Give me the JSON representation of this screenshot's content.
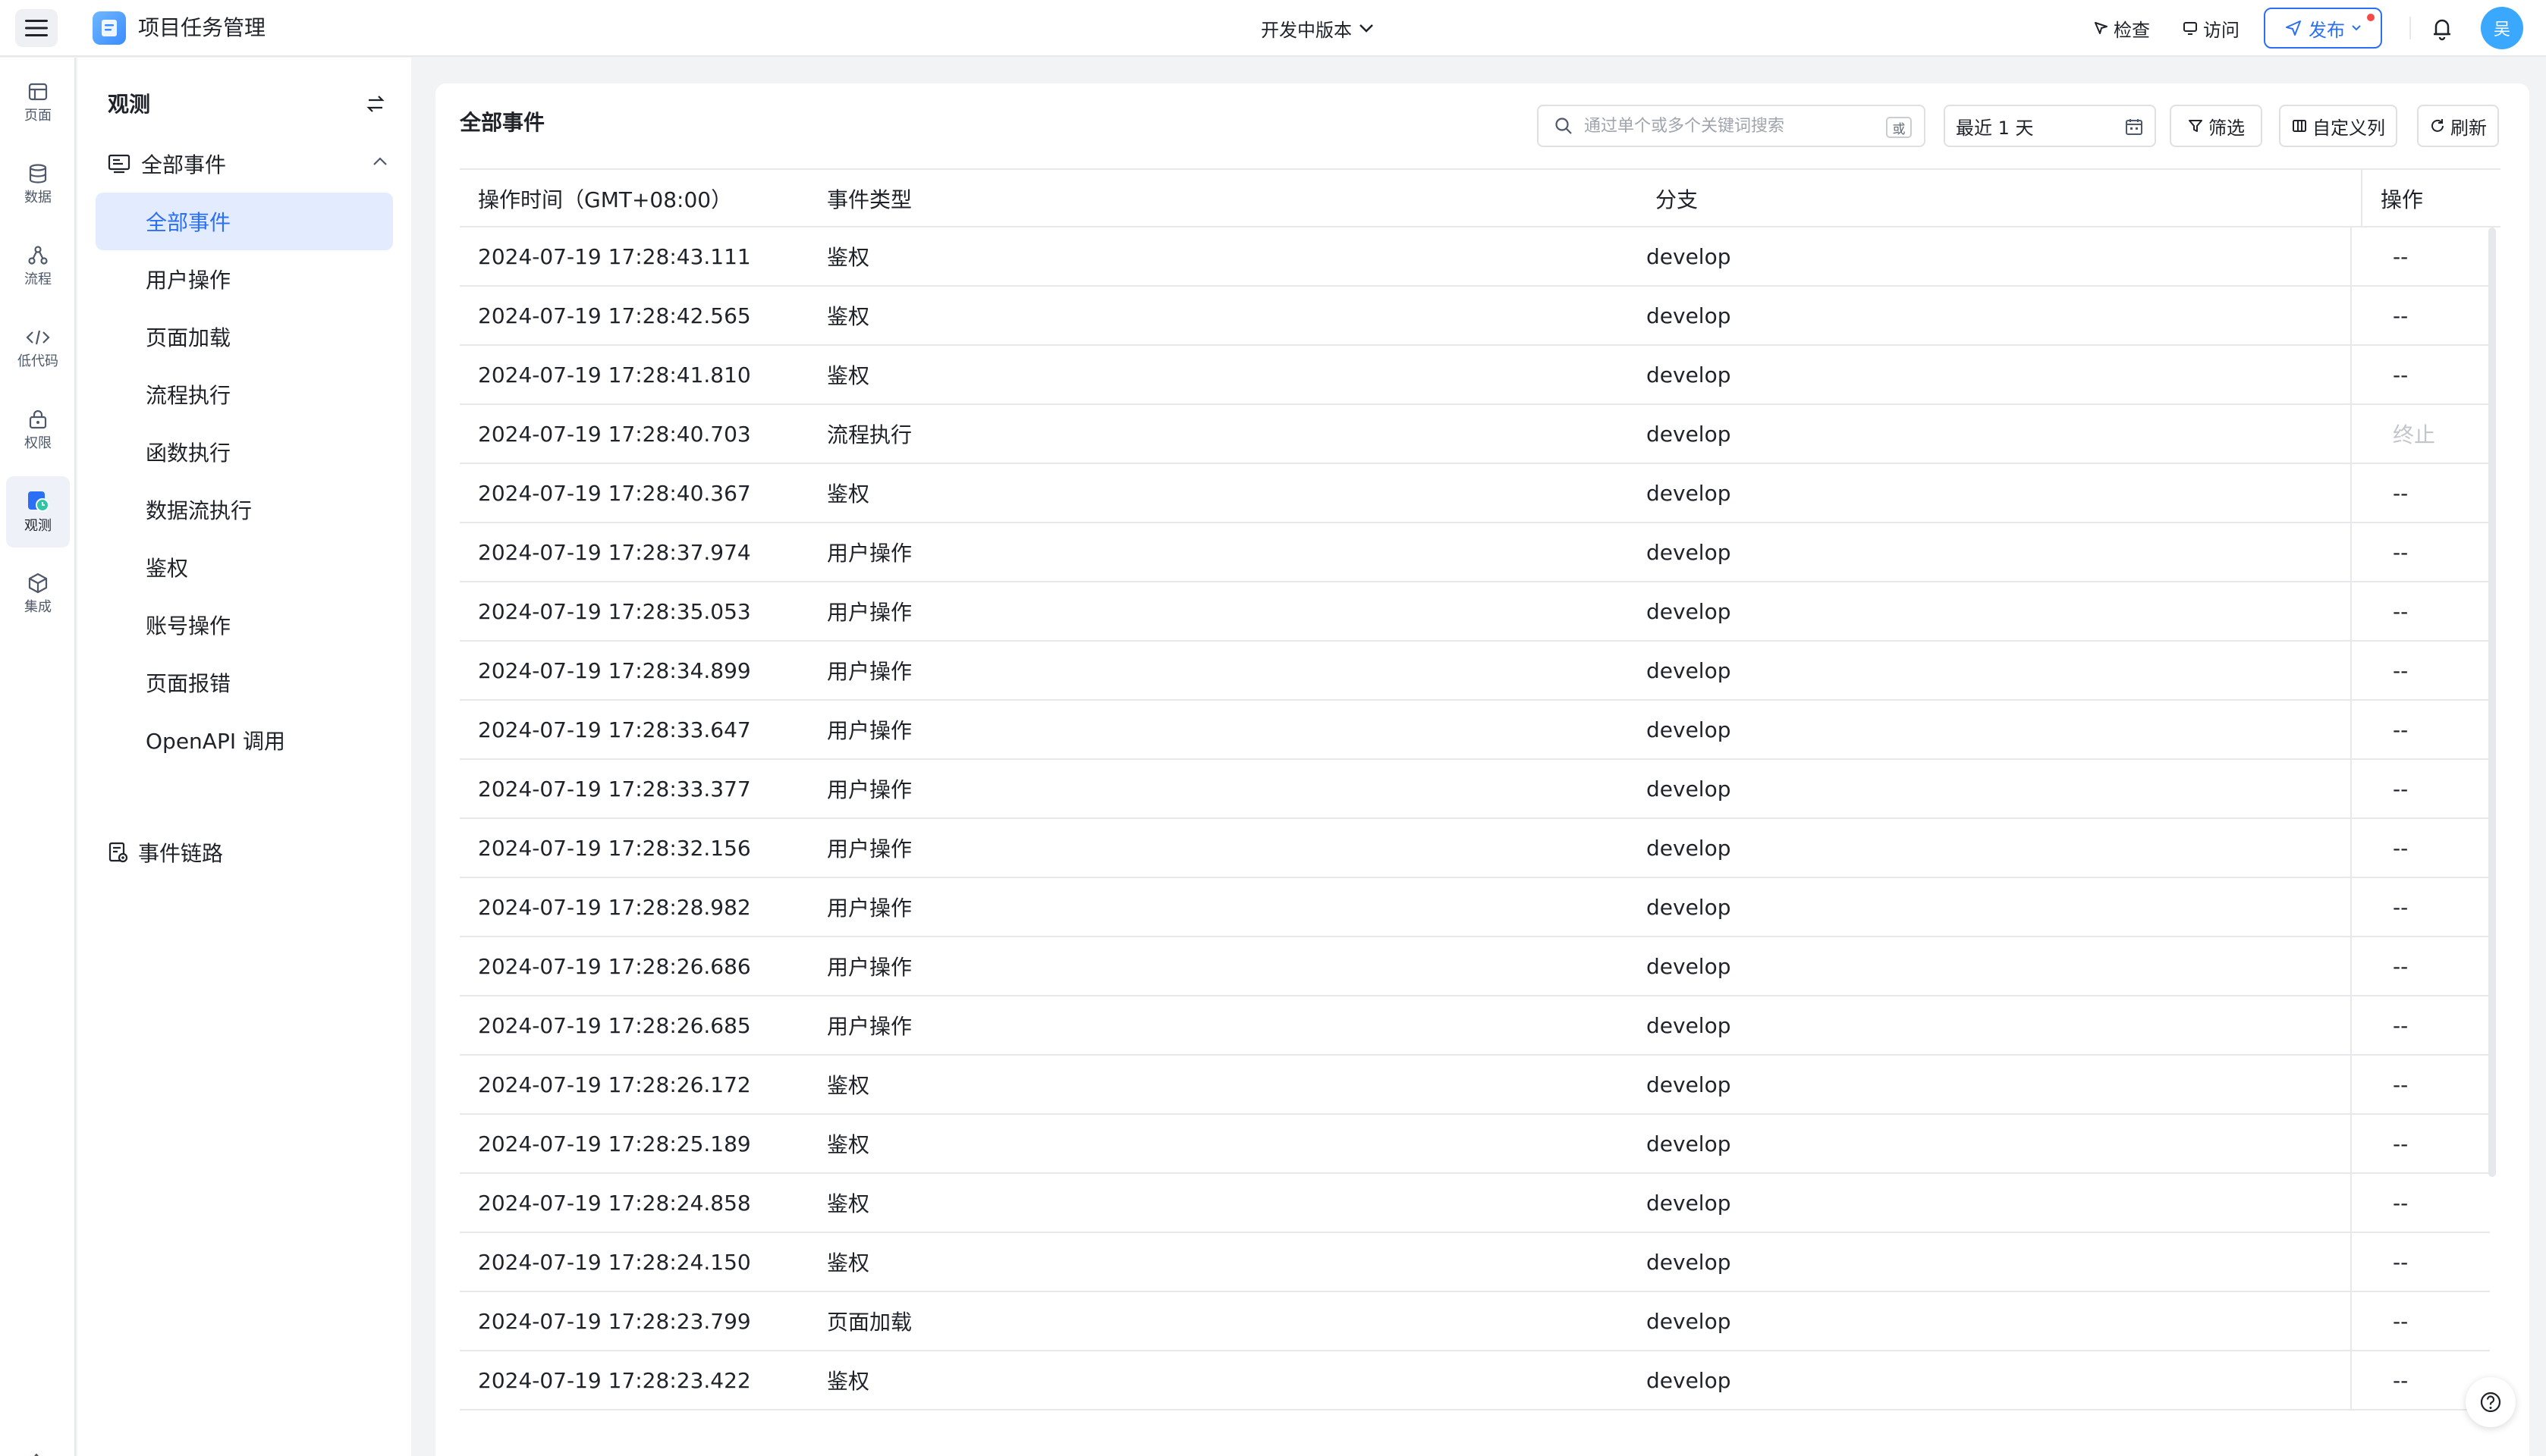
{
  "app": {
    "title": "项目任务管理",
    "version": "开发中版本"
  },
  "topbar": {
    "check": "检查",
    "visit": "访问",
    "publish": "发布",
    "avatar": "吴"
  },
  "rail": [
    {
      "key": "page",
      "label": "页面",
      "icon": "page-icon"
    },
    {
      "key": "data",
      "label": "数据",
      "icon": "database-icon"
    },
    {
      "key": "flow",
      "label": "流程",
      "icon": "flow-icon"
    },
    {
      "key": "lowcode",
      "label": "低代码",
      "icon": "code-icon"
    },
    {
      "key": "permission",
      "label": "权限",
      "icon": "lock-icon"
    },
    {
      "key": "observe",
      "label": "观测",
      "icon": "observe-icon",
      "active": true
    },
    {
      "key": "integration",
      "label": "集成",
      "icon": "cube-icon"
    }
  ],
  "subnav": {
    "title": "观测",
    "group": "全部事件",
    "items": [
      "全部事件",
      "用户操作",
      "页面加载",
      "流程执行",
      "函数执行",
      "数据流执行",
      "鉴权",
      "账号操作",
      "页面报错",
      "OpenAPI 调用"
    ],
    "active_index": 0,
    "group2": "事件链路"
  },
  "main": {
    "title": "全部事件",
    "search": {
      "placeholder": "通过单个或多个关键词搜索",
      "or_label": "或"
    },
    "date_range": "最近 1 天",
    "filter": "筛选",
    "custom_columns": "自定义列",
    "refresh": "刷新"
  },
  "table": {
    "columns": [
      "操作时间（GMT+08:00）",
      "事件类型",
      "分支",
      "操作"
    ],
    "rows": [
      {
        "time": "2024-07-19 17:28:43.111",
        "type": "鉴权",
        "branch": "develop",
        "op": "--"
      },
      {
        "time": "2024-07-19 17:28:42.565",
        "type": "鉴权",
        "branch": "develop",
        "op": "--"
      },
      {
        "time": "2024-07-19 17:28:41.810",
        "type": "鉴权",
        "branch": "develop",
        "op": "--"
      },
      {
        "time": "2024-07-19 17:28:40.703",
        "type": "流程执行",
        "branch": "develop",
        "op": "终止",
        "op_disabled": true
      },
      {
        "time": "2024-07-19 17:28:40.367",
        "type": "鉴权",
        "branch": "develop",
        "op": "--"
      },
      {
        "time": "2024-07-19 17:28:37.974",
        "type": "用户操作",
        "branch": "develop",
        "op": "--"
      },
      {
        "time": "2024-07-19 17:28:35.053",
        "type": "用户操作",
        "branch": "develop",
        "op": "--"
      },
      {
        "time": "2024-07-19 17:28:34.899",
        "type": "用户操作",
        "branch": "develop",
        "op": "--"
      },
      {
        "time": "2024-07-19 17:28:33.647",
        "type": "用户操作",
        "branch": "develop",
        "op": "--"
      },
      {
        "time": "2024-07-19 17:28:33.377",
        "type": "用户操作",
        "branch": "develop",
        "op": "--"
      },
      {
        "time": "2024-07-19 17:28:32.156",
        "type": "用户操作",
        "branch": "develop",
        "op": "--"
      },
      {
        "time": "2024-07-19 17:28:28.982",
        "type": "用户操作",
        "branch": "develop",
        "op": "--"
      },
      {
        "time": "2024-07-19 17:28:26.686",
        "type": "用户操作",
        "branch": "develop",
        "op": "--"
      },
      {
        "time": "2024-07-19 17:28:26.685",
        "type": "用户操作",
        "branch": "develop",
        "op": "--"
      },
      {
        "time": "2024-07-19 17:28:26.172",
        "type": "鉴权",
        "branch": "develop",
        "op": "--"
      },
      {
        "time": "2024-07-19 17:28:25.189",
        "type": "鉴权",
        "branch": "develop",
        "op": "--"
      },
      {
        "time": "2024-07-19 17:28:24.858",
        "type": "鉴权",
        "branch": "develop",
        "op": "--"
      },
      {
        "time": "2024-07-19 17:28:24.150",
        "type": "鉴权",
        "branch": "develop",
        "op": "--"
      },
      {
        "time": "2024-07-19 17:28:23.799",
        "type": "页面加载",
        "branch": "develop",
        "op": "--"
      },
      {
        "time": "2024-07-19 17:28:23.422",
        "type": "鉴权",
        "branch": "develop",
        "op": "--"
      }
    ]
  },
  "colors": {
    "accent": "#2b6ff5",
    "active_bg": "#e3ecff",
    "border": "#e6e8eb",
    "badge_red": "#f54a45"
  }
}
